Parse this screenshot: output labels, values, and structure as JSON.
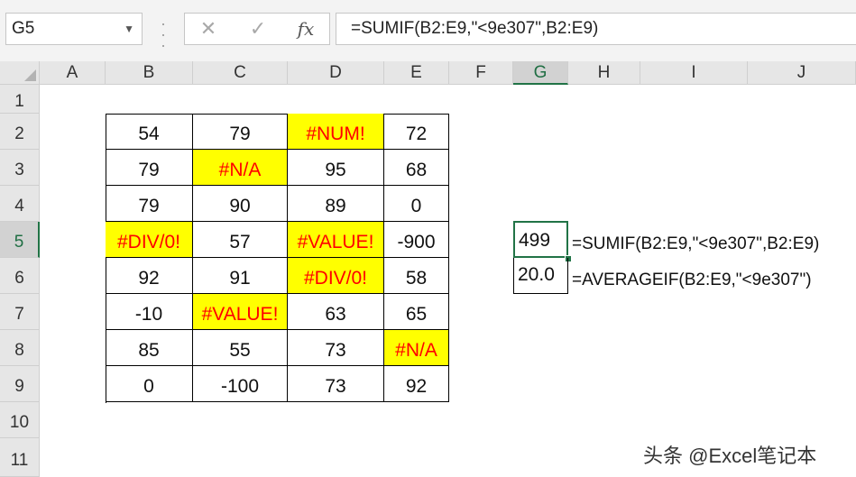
{
  "name_box": "G5",
  "formula_bar": {
    "cancel_glyph": "✕",
    "enter_glyph": "✓",
    "fx_glyph": "fx",
    "formula": "=SUMIF(B2:E9,\"<9e307\",B2:E9)"
  },
  "columns": [
    "A",
    "B",
    "C",
    "D",
    "E",
    "F",
    "G",
    "H",
    "I",
    "J"
  ],
  "selected_column": "G",
  "rows": [
    "1",
    "2",
    "3",
    "4",
    "5",
    "6",
    "7",
    "8",
    "9",
    "10",
    "11"
  ],
  "selected_row": "5",
  "table": [
    [
      {
        "v": "54",
        "err": false
      },
      {
        "v": "79",
        "err": false
      },
      {
        "v": "#NUM!",
        "err": true
      },
      {
        "v": "72",
        "err": false
      }
    ],
    [
      {
        "v": "79",
        "err": false
      },
      {
        "v": "#N/A",
        "err": true
      },
      {
        "v": "95",
        "err": false
      },
      {
        "v": "68",
        "err": false
      }
    ],
    [
      {
        "v": "79",
        "err": false
      },
      {
        "v": "90",
        "err": false
      },
      {
        "v": "89",
        "err": false
      },
      {
        "v": "0",
        "err": false
      }
    ],
    [
      {
        "v": "#DIV/0!",
        "err": true
      },
      {
        "v": "57",
        "err": false
      },
      {
        "v": "#VALUE!",
        "err": true
      },
      {
        "v": "-900",
        "err": false
      }
    ],
    [
      {
        "v": "92",
        "err": false
      },
      {
        "v": "91",
        "err": false
      },
      {
        "v": "#DIV/0!",
        "err": true
      },
      {
        "v": "58",
        "err": false
      }
    ],
    [
      {
        "v": "-10",
        "err": false
      },
      {
        "v": "#VALUE!",
        "err": true
      },
      {
        "v": "63",
        "err": false
      },
      {
        "v": "65",
        "err": false
      }
    ],
    [
      {
        "v": "85",
        "err": false
      },
      {
        "v": "55",
        "err": false
      },
      {
        "v": "73",
        "err": false
      },
      {
        "v": "#N/A",
        "err": true
      }
    ],
    [
      {
        "v": "0",
        "err": false
      },
      {
        "v": "-100",
        "err": false
      },
      {
        "v": "73",
        "err": false
      },
      {
        "v": "92",
        "err": false
      }
    ]
  ],
  "results": {
    "g5_value": "499",
    "g5_formula": "=SUMIF(B2:E9,\"<9e307\",B2:E9)",
    "g6_value": "20.0",
    "g6_formula": "=AVERAGEIF(B2:E9,\"<9e307\")"
  },
  "watermark": "头条 @Excel笔记本",
  "colors": {
    "error_fill": "#ffff00",
    "error_text": "#ff0000",
    "selection": "#217346"
  }
}
